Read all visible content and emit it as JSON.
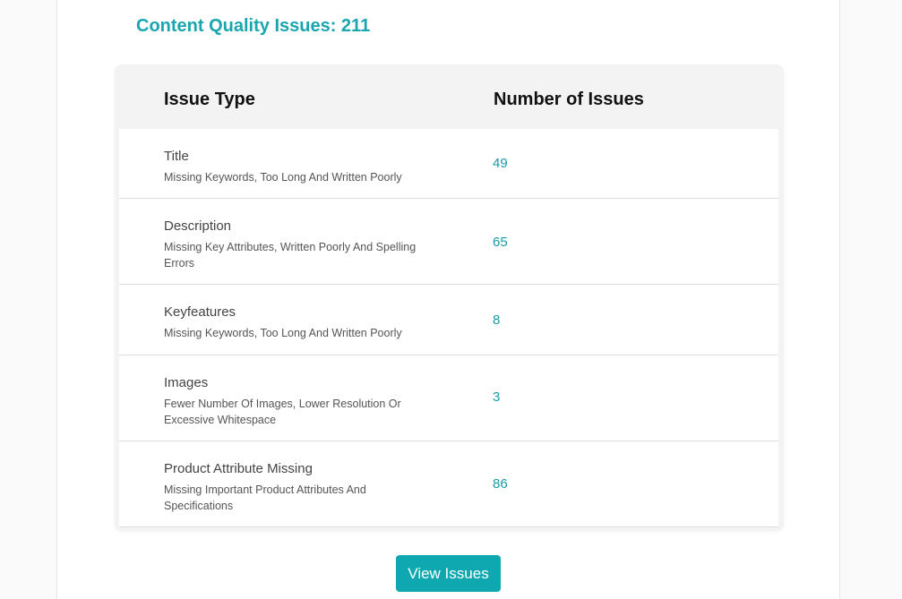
{
  "heading": "Content Quality Issues: 211",
  "table": {
    "headers": {
      "type": "Issue Type",
      "count": "Number of Issues"
    },
    "rows": [
      {
        "name": "Title",
        "desc": "Missing Keywords, Too Long And Written Poorly",
        "count": "49"
      },
      {
        "name": "Description",
        "desc": "Missing Key Attributes, Written Poorly And Spelling Errors",
        "count": "65"
      },
      {
        "name": "Keyfeatures",
        "desc": "Missing Keywords, Too Long And Written Poorly",
        "count": "8"
      },
      {
        "name": "Images",
        "desc": "Fewer Number Of Images, Lower Resolution Or Excessive Whitespace",
        "count": "3"
      },
      {
        "name": "Product Attribute Missing",
        "desc": "Missing Important Product Attributes And Specifications",
        "count": "86"
      }
    ]
  },
  "button": {
    "label": "View Issues"
  },
  "colors": {
    "accent": "#1aa6b0",
    "button": "#0fa8b0"
  }
}
